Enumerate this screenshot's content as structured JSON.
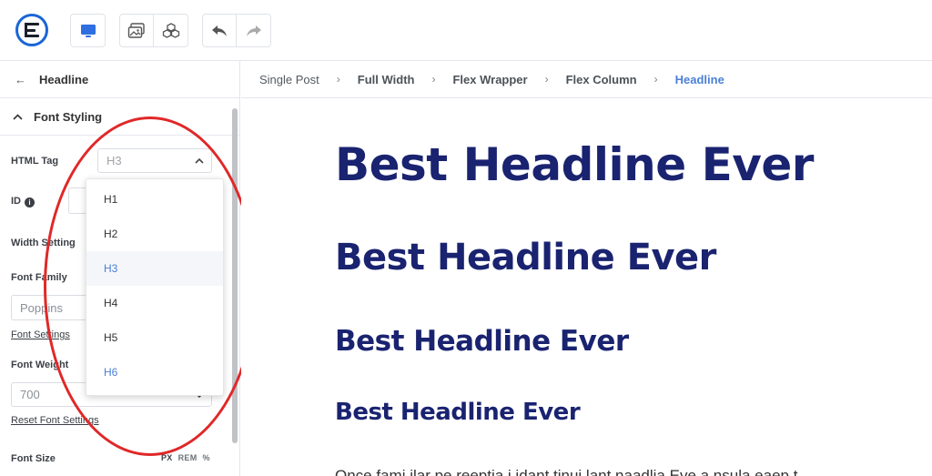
{
  "toolbar": {
    "logo_icon": "elementor-e-logo-icon",
    "device_icon": "desktop-icon",
    "image_icon": "images-icon",
    "widgets_icon": "cubes-icon",
    "undo_icon": "undo-icon",
    "redo_icon": "redo-icon",
    "accent_color": "#1a66d6"
  },
  "sidebar": {
    "back_icon": "←",
    "title": "Headline",
    "section": {
      "chevron_icon": "chevron-up-icon",
      "label": "Font Styling"
    },
    "html_tag": {
      "label": "HTML Tag",
      "value": "H3",
      "caret": "⌃"
    },
    "id_field": {
      "label": "ID",
      "info_icon": "i"
    },
    "width_setting": {
      "label": "Width Setting"
    },
    "font_family": {
      "label": "Font Family",
      "placeholder": "Poppins",
      "settings_link": "Font Settings"
    },
    "font_weight": {
      "label": "Font Weight",
      "value": "700",
      "reset_link": "Reset Font Settings"
    },
    "font_size": {
      "label": "Font Size",
      "units": [
        "PX",
        "REM",
        "%"
      ]
    },
    "dropdown": {
      "options": [
        "H1",
        "H2",
        "H3",
        "H4",
        "H5",
        "H6"
      ],
      "selected": "H3",
      "selected_color": "#4b7fd6"
    },
    "annotation_color": "#e02828"
  },
  "breadcrumb": {
    "items": [
      "Single Post",
      "Full Width",
      "Flex Wrapper",
      "Flex Column",
      "Headline"
    ],
    "separator": "›",
    "active_color": "#4b7fd6"
  },
  "canvas": {
    "headline_color": "#1a2370",
    "headlines": [
      "Best Headline Ever",
      "Best Headline Ever",
      "Best Headline Ever",
      "Best Headline Ever"
    ],
    "paragraph": "Once fami ilar pe reeptia i idant tinui lant naadlia Eve a nsula eaep t"
  }
}
